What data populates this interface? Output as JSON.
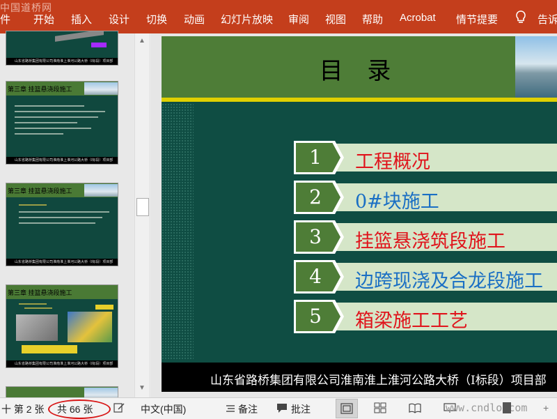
{
  "ribbon": {
    "watermark": "中国道桥网",
    "tabs": [
      "件",
      "开始",
      "插入",
      "设计",
      "切换",
      "动画",
      "幻灯片放映",
      "审阅",
      "视图",
      "帮助",
      "Acrobat",
      "情节提要",
      "告诉"
    ]
  },
  "thumbnails": [
    {
      "header": "",
      "footer": "山东省路桥集团有限公司淮南淮上淮河公路大桥（I标段）项目部"
    },
    {
      "header": "第三章  挂篮悬浇段施工",
      "footer": "山东省路桥集团有限公司淮南淮上淮河公路大桥（I标段）项目部"
    },
    {
      "header": "第三章  挂篮悬浇段施工",
      "footer": "山东省路桥集团有限公司淮南淮上淮河公路大桥（I标段）项目部"
    },
    {
      "header": "第三章  挂篮悬浇段施工",
      "footer": "山东省路桥集团有限公司淮南淮上淮河公路大桥（I标段）项目部"
    },
    {
      "header": "",
      "footer": ""
    }
  ],
  "slide": {
    "title": "目  录",
    "items": [
      {
        "num": "1",
        "label": "工程概况",
        "color": "#e0141c"
      },
      {
        "num": "2",
        "label": "0#块施工",
        "color": "#1a6fc4"
      },
      {
        "num": "3",
        "label": "挂篮悬浇筑段施工",
        "color": "#e0141c"
      },
      {
        "num": "4",
        "label": "边跨现浇及合龙段施工",
        "color": "#1a6fc4"
      },
      {
        "num": "5",
        "label": "箱梁施工工艺",
        "color": "#e0141c"
      }
    ],
    "footer": "山东省路桥集团有限公司淮南淮上淮河公路大桥（I标段）项目部"
  },
  "status": {
    "slide_pos": "十 第 2 张",
    "total": "共 66 张",
    "language": "中文(中国)",
    "notes": "备注",
    "comments": "批注",
    "watermark": "www.cndlo.com"
  }
}
